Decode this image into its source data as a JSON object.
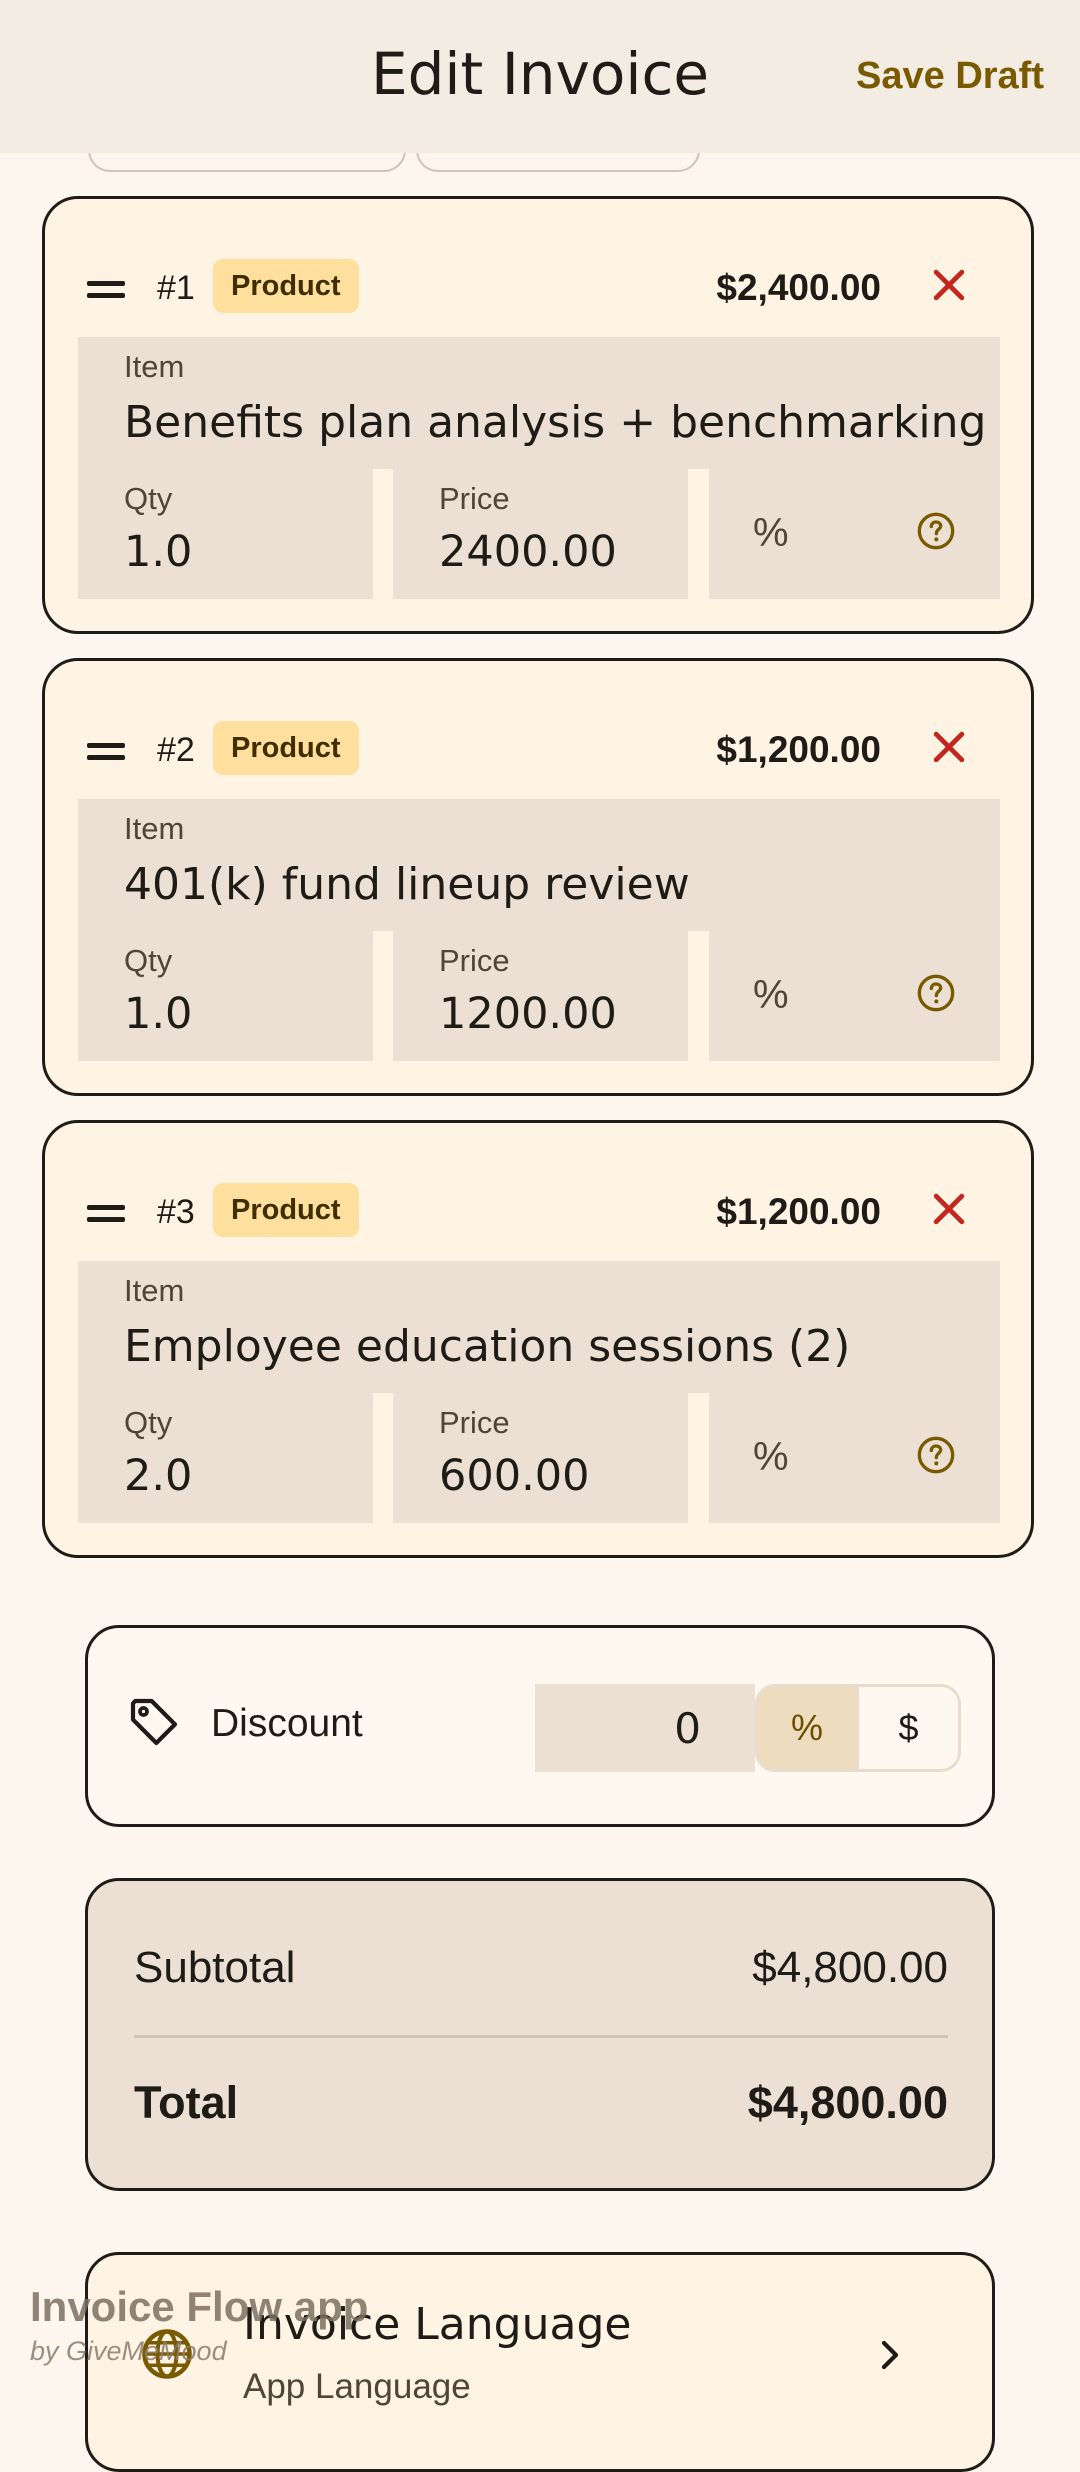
{
  "header": {
    "title": "Edit Invoice",
    "save_label": "Save Draft"
  },
  "items": [
    {
      "num": "#1",
      "badge": "Product",
      "amount": "$2,400.00",
      "item_label": "Item",
      "item": "Benefits plan analysis + benchmarking",
      "qty_label": "Qty",
      "qty": "1.0",
      "price_label": "Price",
      "price": "2400.00",
      "pct": "%"
    },
    {
      "num": "#2",
      "badge": "Product",
      "amount": "$1,200.00",
      "item_label": "Item",
      "item": "401(k) fund lineup review",
      "qty_label": "Qty",
      "qty": "1.0",
      "price_label": "Price",
      "price": "1200.00",
      "pct": "%"
    },
    {
      "num": "#3",
      "badge": "Product",
      "amount": "$1,200.00",
      "item_label": "Item",
      "item": "Employee education sessions (2)",
      "qty_label": "Qty",
      "qty": "2.0",
      "price_label": "Price",
      "price": "600.00",
      "pct": "%"
    }
  ],
  "discount": {
    "label": "Discount",
    "value": "0",
    "percent": "%",
    "dollar": "$",
    "selected": "%"
  },
  "totals": {
    "subtotal_label": "Subtotal",
    "subtotal": "$4,800.00",
    "total_label": "Total",
    "total": "$4,800.00"
  },
  "language": {
    "title": "Invoice Language",
    "subtitle": "App Language"
  },
  "watermark": {
    "app": "Invoice Flow app",
    "by": "by GiveMeMood"
  },
  "colors": {
    "accent": "#7a5a00",
    "delete": "#c4261d",
    "badge": "#ffdf9e",
    "field": "#ebe0d3"
  }
}
